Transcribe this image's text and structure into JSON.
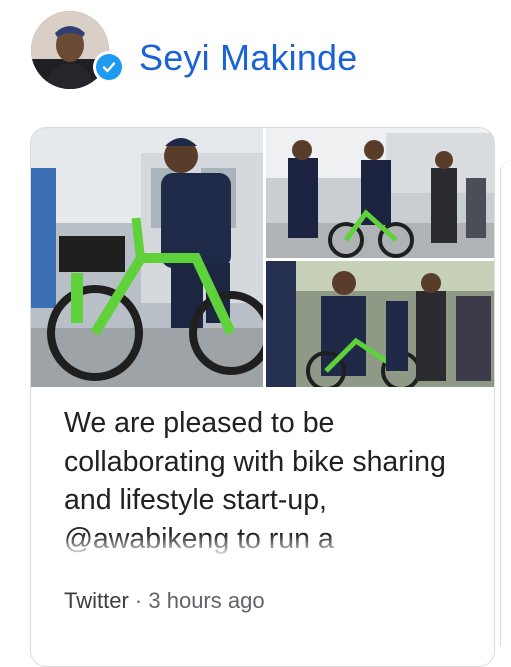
{
  "author": {
    "name": "Seyi Makinde",
    "avatar_icon": "avatar-photo",
    "verified_icon": "verified-check-icon"
  },
  "tweet": {
    "text": "We are pleased to be collaborating with bike sharing and lifestyle start-up, @awabikeng to run a",
    "photos": [
      "photo-main-green-bike",
      "photo-group-riding",
      "photo-crowd-bikes"
    ]
  },
  "meta": {
    "source": "Twitter",
    "separator": "·",
    "time": "3 hours ago"
  },
  "colors": {
    "name": "#1a62d6",
    "verified": "#1d9bf0",
    "bike": "#5fd13a",
    "border": "#dadce0",
    "meta": "#5f6368"
  }
}
